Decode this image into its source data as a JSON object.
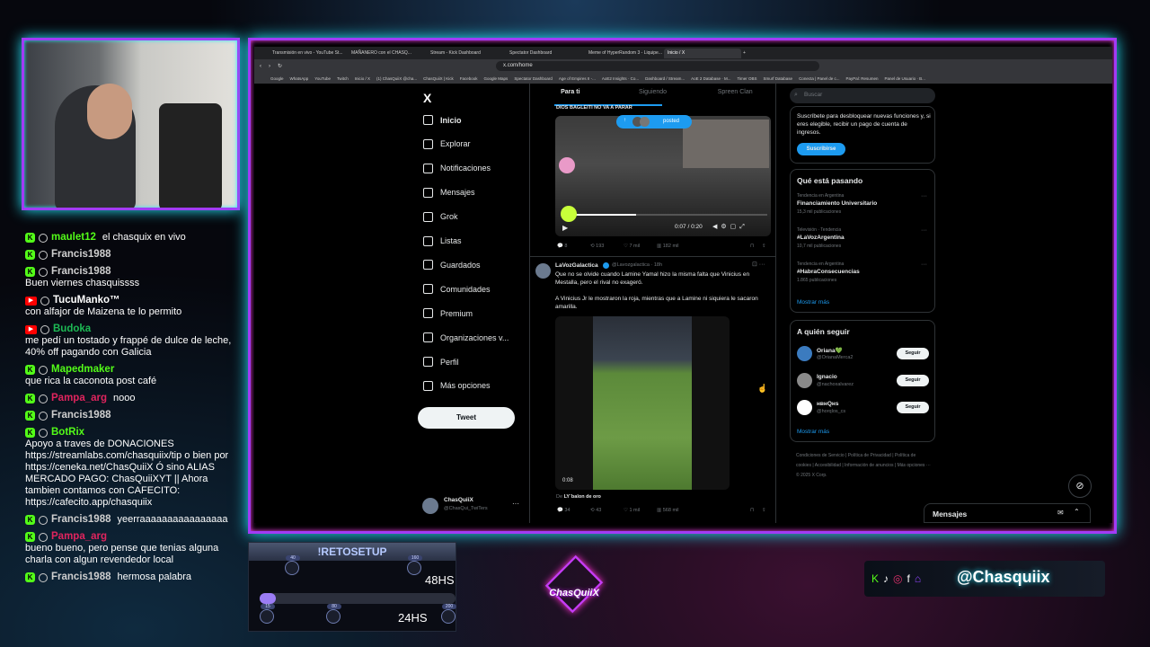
{
  "chat": {
    "messages": [
      {
        "platform": "kick",
        "user": "maulet12",
        "color": "#53fc18",
        "text": "el chasquix en vivo"
      },
      {
        "platform": "kick",
        "user": "Francis1988",
        "color": "#cfcfcf",
        "text": ""
      },
      {
        "platform": "kick",
        "user": "Francis1988",
        "color": "#cfcfcf",
        "text": "Buen viernes chasquissss"
      },
      {
        "platform": "youtube",
        "user": "TucuManko™",
        "color": "#ffffff",
        "text": "con alfajor de Maizena te lo permito"
      },
      {
        "platform": "youtube",
        "user": "Budoka",
        "color": "#1db954",
        "text": "me pedí un tostado y frappé de dulce de leche, 40% off pagando con Galicia"
      },
      {
        "platform": "kick",
        "user": "Mapedmaker",
        "color": "#53fc18",
        "text": "que rica la caconota post café"
      },
      {
        "platform": "kick",
        "user": "Pampa_arg",
        "color": "#e0245e",
        "text": "nooo"
      },
      {
        "platform": "kick",
        "user": "Francis1988",
        "color": "#cfcfcf",
        "text": ""
      },
      {
        "platform": "kick",
        "user": "BotRix",
        "color": "#53fc18",
        "text": "Apoyo a traves de DONACIONES https://streamlabs.com/chasquiix/tip o bien por https://ceneka.net/ChasQuiiX Ó sino ALIAS MERCADO PAGO: ChasQuiiXYT || Ahora tambien contamos con CAFECITO: https://cafecito.app/chasquiix"
      },
      {
        "platform": "kick",
        "user": "Francis1988",
        "color": "#cfcfcf",
        "text": "yeerraaaaaaaaaaaaaaaa"
      },
      {
        "platform": "kick",
        "user": "Pampa_arg",
        "color": "#e0245e",
        "text": "bueno bueno, pero pense que tenias alguna charla con algun revendedor local"
      },
      {
        "platform": "kick",
        "user": "Francis1988",
        "color": "#cfcfcf",
        "text": "hermosa palabra"
      }
    ]
  },
  "browser": {
    "tabs": [
      "Transmisión en vivo - YouTube St...",
      "MAÑANERO con el CHASQ...",
      "Stream - Kick Dashboard",
      "Spectator Dashboard",
      "Meme of HyperRandom 3 - Liquipe...",
      "Inicio / X"
    ],
    "active_tab": "Inicio / X",
    "url": "x.com/home",
    "bookmarks": [
      "Google",
      "WhatsApp",
      "YouTube",
      "Twitch",
      "Inicio / X",
      "(1) ChasQuiiX @cha...",
      "ChasQuiiX | Kick",
      "Facebook",
      "Google Maps",
      "Spectator Dashboard",
      "Age of Empires II -...",
      "AoE2 Insights · Co...",
      "Dashboard / Stream...",
      "AoE 2 Database · M...",
      "Timer OBS",
      "Smurf Database",
      "Conecta | Panel de c...",
      "PayPal: Resumen",
      "Panel de Usuario · B..."
    ]
  },
  "x": {
    "logo": "X",
    "nav": [
      "Inicio",
      "Explorar",
      "Notificaciones",
      "Mensajes",
      "Grok",
      "Listas",
      "Guardados",
      "Comunidades",
      "Premium",
      "Organizaciones v...",
      "Perfil",
      "Más opciones"
    ],
    "tweet_button": "Tweet",
    "profile": {
      "name": "ChasQuiiX",
      "handle": "@ChasQui_TwiTers"
    },
    "feed_tabs": [
      "Para ti",
      "Siguiendo",
      "Spreen Clan"
    ],
    "posted_pill": "posted",
    "post1": {
      "header": "DIOS BAGLEITI NO VA A PARAR",
      "time": "0:07 / 0:20",
      "stats": [
        "8",
        "193",
        "7 mil",
        "182 mil"
      ]
    },
    "post2": {
      "name": "LaVozGalactica",
      "handle": "@Lavozgalactica · 18h",
      "text1": "Que no se olvide cuando Lamine Yamal hizo la misma falta que Vinicius en Mestalla, pero el rival no exageró.",
      "text2": "A Vinicius Jr le mostraron la roja, mientras que a Lamine ni siquiera le sacaron amarilla.",
      "video_time": "0:08",
      "from": "De",
      "from_user": "LY`balon de oro",
      "stats": [
        "34",
        "43",
        "1 mil",
        "568 mil"
      ]
    },
    "search_placeholder": "Buscar",
    "premium_text": "Suscríbete para desbloquear nuevas funciones y, si eres elegible, recibir un pago de cuenta de ingresos.",
    "premium_button": "Suscribirse",
    "trends_title": "Qué está pasando",
    "trends": [
      {
        "context": "Tendencia en Argentina",
        "name": "Financiamiento Universitario",
        "count": "15,3 mil publicaciones"
      },
      {
        "context": "Televisión · Tendencia",
        "name": "#LaVozArgentina",
        "count": "10,7 mil publicaciones"
      },
      {
        "context": "Tendencia en Argentina",
        "name": "#HabraConsecuencias",
        "count": "1.865 publicaciones"
      }
    ],
    "show_more": "Mostrar más",
    "follow_title": "A quién seguir",
    "follow": [
      {
        "name": "Oriana💚",
        "handle": "@OrianaMerca2",
        "btn": "Seguir"
      },
      {
        "name": "Ignacio",
        "handle": "@nachoxalvarez",
        "btn": "Seguir"
      },
      {
        "name": "нвнQнѕ",
        "handle": "@horqlos_cs",
        "btn": "Seguir"
      }
    ],
    "footer": "Condiciones de Servicio | Política de Privacidad | Política de cookies | Accesibilidad | Información de anuncios | Más opciones ··· © 2025 X Corp.",
    "messages_drawer": "Mensajes"
  },
  "overlay": {
    "reto_title": "!RETOSETUP",
    "reto_48": "48HS",
    "reto_24": "24HS",
    "reto_marks": [
      "40",
      "160",
      "15",
      "80",
      "200"
    ],
    "logo_text": "ChasQuiiX",
    "social_handle": "@Chasquiix"
  },
  "colors": {
    "neon_purple": "#a23bf5",
    "neon_cyan": "#25e7ff",
    "kick_green": "#53fc18",
    "x_blue": "#1d9bf0"
  }
}
